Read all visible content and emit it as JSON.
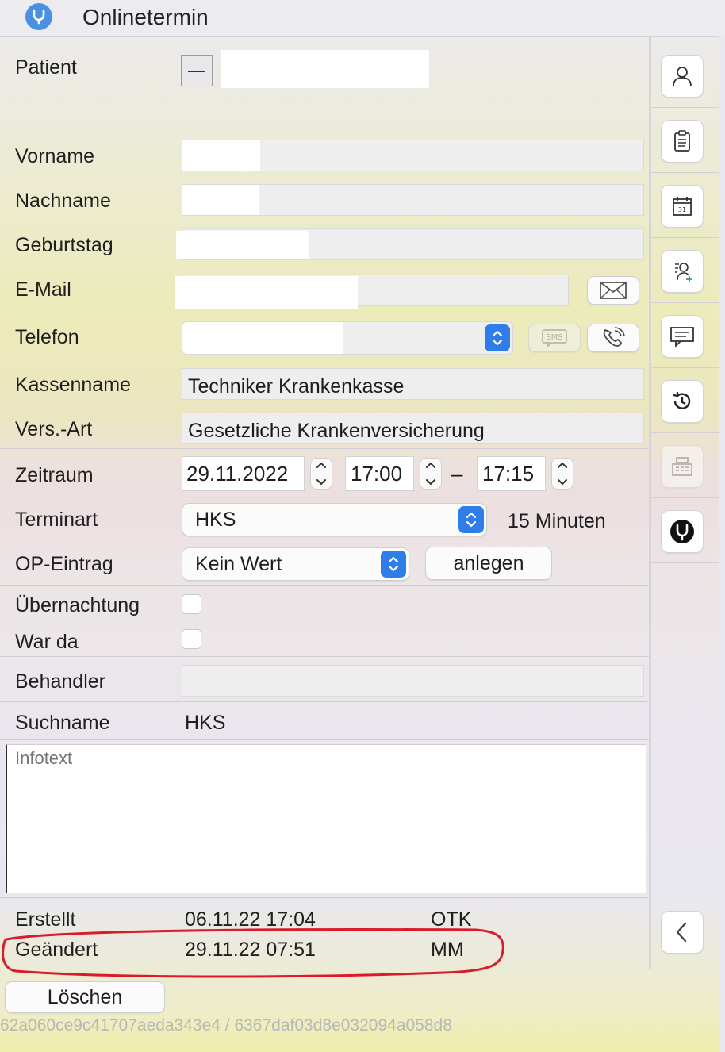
{
  "window": {
    "title": "Onlinetermin"
  },
  "icons": {
    "app": "stethoscope-icon",
    "collapse": "minus-icon",
    "mail": "envelope-icon",
    "sms": "sms-icon",
    "phone": "phone-icon"
  },
  "patient": {
    "label": "Patient",
    "collapse_symbol": "—"
  },
  "fields": {
    "vorname": {
      "label": "Vorname",
      "value": ""
    },
    "nachname": {
      "label": "Nachname",
      "value": ""
    },
    "geburtstag": {
      "label": "Geburtstag",
      "value": ""
    },
    "email": {
      "label": "E-Mail",
      "value": ""
    },
    "telefon": {
      "label": "Telefon",
      "value": ""
    },
    "kassenname": {
      "label": "Kassenname",
      "value": "Techniker Krankenkasse"
    },
    "versart": {
      "label": "Vers.-Art",
      "value": "Gesetzliche Krankenversicherung"
    }
  },
  "zeitraum": {
    "label": "Zeitraum",
    "date": "29.11.2022",
    "start": "17:00",
    "separator": "–",
    "end": "17:15"
  },
  "terminart": {
    "label": "Terminart",
    "value": "HKS",
    "duration": "15 Minuten"
  },
  "op_eintrag": {
    "label": "OP-Eintrag",
    "value": "Kein Wert",
    "button": "anlegen"
  },
  "uebernachtung": {
    "label": "Übernachtung",
    "checked": false
  },
  "war_da": {
    "label": "War da",
    "checked": false
  },
  "behandler": {
    "label": "Behandler",
    "value": ""
  },
  "suchname": {
    "label": "Suchname",
    "value": "HKS"
  },
  "infotext": {
    "placeholder": "Infotext",
    "value": ""
  },
  "erstellt": {
    "label": "Erstellt",
    "datetime": "06.11.22 17:04",
    "user": "OTK"
  },
  "geaendert": {
    "label": "Geändert",
    "datetime": "29.11.22 07:51",
    "user": "MM"
  },
  "loeschen": {
    "label": "Löschen"
  },
  "footer": {
    "ids": "62a060ce9c41707aeda343e4 / 6367daf03d8e032094a058d8"
  },
  "sidebar": {
    "buttons": [
      "person-icon",
      "clipboard-icon",
      "calendar-icon",
      "add-patient-icon",
      "message-icon",
      "history-icon",
      "cash-register-icon",
      "stethoscope-icon"
    ],
    "collapse": "chevron-left-icon"
  },
  "colors": {
    "accent": "#2f7de8",
    "highlight_circle": "#d81c2a"
  }
}
